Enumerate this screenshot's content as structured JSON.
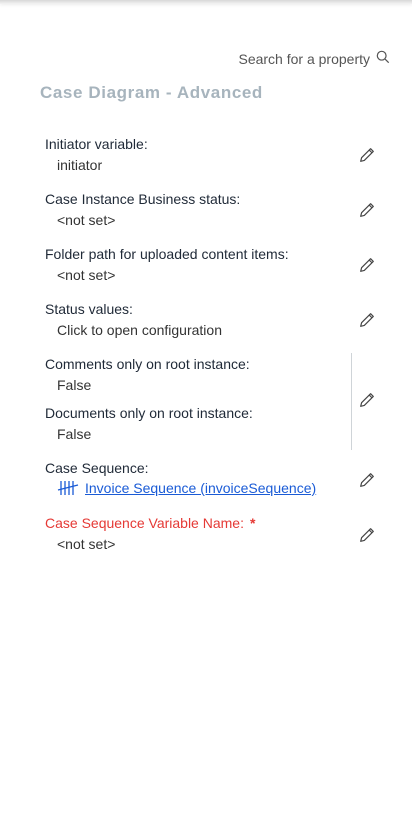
{
  "search": {
    "placeholder": "Search for a property"
  },
  "panel": {
    "title": "Case Diagram - Advanced"
  },
  "properties": [
    {
      "label": "Initiator variable:",
      "value": "initiator"
    },
    {
      "label": "Case Instance Business status:",
      "value": "<not set>"
    },
    {
      "label": "Folder path for uploaded content items:",
      "value": "<not set>"
    },
    {
      "label": "Status values:",
      "value": "Click to open configuration"
    },
    {
      "label": "Comments only on root instance:",
      "value": "False"
    },
    {
      "label": "Documents only on root instance:",
      "value": "False"
    },
    {
      "label": "Case Sequence:",
      "value": "Invoice Sequence (invoiceSequence)"
    },
    {
      "label": "Case Sequence Variable Name:",
      "value": "<not set>",
      "required_mark": "*"
    }
  ],
  "colors": {
    "link": "#1a5bd6",
    "required": "#e53935",
    "title": "#a7b4bd"
  }
}
